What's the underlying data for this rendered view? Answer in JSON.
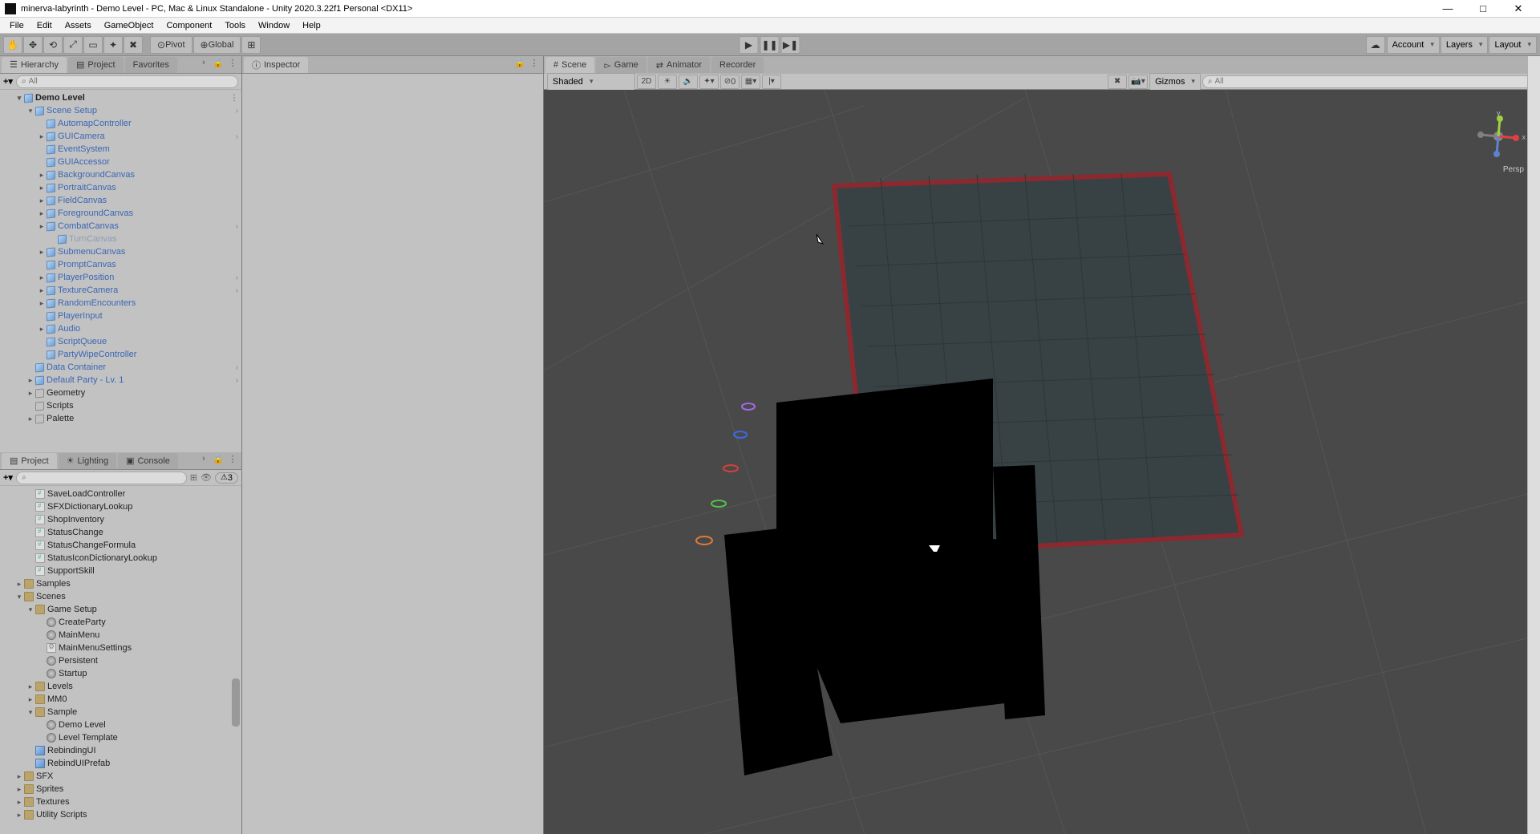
{
  "title": "minerva-labyrinth - Demo Level - PC, Mac & Linux Standalone - Unity 2020.3.22f1 Personal <DX11>",
  "menu": [
    "File",
    "Edit",
    "Assets",
    "GameObject",
    "Component",
    "Tools",
    "Window",
    "Help"
  ],
  "toolstrip": {
    "pivot": "Pivot",
    "global": "Global",
    "account": "Account",
    "layers": "Layers",
    "layout": "Layout"
  },
  "hierarchy": {
    "tab": "Hierarchy",
    "search_ph": "All",
    "root": "Demo Level",
    "sceneSetup": "Scene Setup",
    "items": [
      {
        "label": "AutomapController",
        "icon": "prefab"
      },
      {
        "label": "GUICamera",
        "icon": "prefab",
        "exp": true,
        "chain": true
      },
      {
        "label": "EventSystem",
        "icon": "prefab"
      },
      {
        "label": "GUIAccessor",
        "icon": "prefab"
      },
      {
        "label": "BackgroundCanvas",
        "icon": "prefab",
        "exp": true
      },
      {
        "label": "PortraitCanvas",
        "icon": "prefab",
        "exp": true
      },
      {
        "label": "FieldCanvas",
        "icon": "prefab",
        "exp": true
      },
      {
        "label": "ForegroundCanvas",
        "icon": "prefab",
        "exp": true
      },
      {
        "label": "CombatCanvas",
        "icon": "prefab",
        "exp": true,
        "chain": true
      },
      {
        "label": "TurnCanvas",
        "icon": "prefab",
        "disabled": true,
        "indent": 1
      },
      {
        "label": "SubmenuCanvas",
        "icon": "prefab",
        "exp": true
      },
      {
        "label": "PromptCanvas",
        "icon": "prefab"
      },
      {
        "label": "PlayerPosition",
        "icon": "prefab",
        "exp": true,
        "chain": true
      },
      {
        "label": "TextureCamera",
        "icon": "prefab",
        "exp": true,
        "chain": true
      },
      {
        "label": "RandomEncounters",
        "icon": "prefab",
        "exp": true
      },
      {
        "label": "PlayerInput",
        "icon": "prefab"
      },
      {
        "label": "Audio",
        "icon": "prefab",
        "exp": true
      },
      {
        "label": "ScriptQueue",
        "icon": "prefab"
      },
      {
        "label": "PartyWipeController",
        "icon": "prefab"
      }
    ],
    "rootItems": [
      {
        "label": "Data Container",
        "icon": "prefab",
        "chain": true
      },
      {
        "label": "Default Party - Lv. 1",
        "icon": "prefab",
        "exp": true,
        "chain": true
      },
      {
        "label": "Geometry",
        "icon": "plain",
        "exp": true
      },
      {
        "label": "Scripts",
        "icon": "plain"
      },
      {
        "label": "Palette",
        "icon": "plain",
        "exp": true
      }
    ]
  },
  "project": {
    "tabs": [
      "Project",
      "Lighting",
      "Console"
    ],
    "favorites": "Favorites",
    "search_ph": "",
    "warnCount": "3",
    "scripts": [
      "SaveLoadController",
      "SFXDictionaryLookup",
      "ShopInventory",
      "StatusChange",
      "StatusChangeFormula",
      "StatusIconDictionaryLookup",
      "SupportSkill"
    ],
    "folders": [
      {
        "label": "Samples",
        "exp": true
      },
      {
        "label": "Scenes",
        "open": true,
        "children": [
          {
            "label": "Game Setup",
            "open": true,
            "children": [
              {
                "label": "CreateParty",
                "type": "scene"
              },
              {
                "label": "MainMenu",
                "type": "scene"
              },
              {
                "label": "MainMenuSettings",
                "type": "settings"
              },
              {
                "label": "Persistent",
                "type": "scene"
              },
              {
                "label": "Startup",
                "type": "scene"
              }
            ]
          },
          {
            "label": "Levels",
            "exp": true
          },
          {
            "label": "MM0",
            "exp": true
          },
          {
            "label": "Sample",
            "open": true,
            "children": [
              {
                "label": "Demo Level",
                "type": "scene"
              },
              {
                "label": "Level Template",
                "type": "scene"
              }
            ]
          }
        ]
      },
      {
        "label": "RebindingUI",
        "type": "prefab",
        "flat": true
      },
      {
        "label": "RebindUIPrefab",
        "type": "prefab",
        "flat": true
      },
      {
        "label": "SFX",
        "exp": true
      },
      {
        "label": "Sprites",
        "exp": true
      },
      {
        "label": "Textures",
        "exp": true
      },
      {
        "label": "Utility Scripts",
        "exp": true
      }
    ]
  },
  "inspector": {
    "tab": "Inspector"
  },
  "sceneview": {
    "tabs": [
      "Scene",
      "Game",
      "Animator",
      "Recorder"
    ],
    "shading": "Shaded",
    "twoD": "2D",
    "zeroVal": "0",
    "gizmos": "Gizmos",
    "search_ph": "All",
    "persp": "Persp",
    "axis_x": "x",
    "axis_y": "y"
  }
}
